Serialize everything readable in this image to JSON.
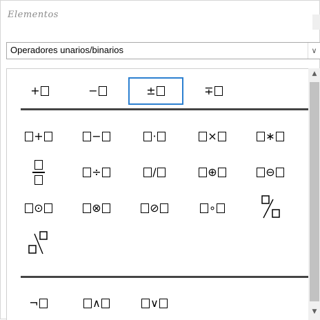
{
  "panel": {
    "title": "Elementos"
  },
  "category": {
    "selected": "Operadores unarios/binarios"
  },
  "icons": {
    "dropdown": "chevron-down-icon",
    "scroll_up": "chevron-up-icon",
    "scroll_down": "chevron-down-icon"
  },
  "colors": {
    "selection_border": "#2b7fd0",
    "separator": "#444444",
    "scrollbar_thumb": "#c2c2c2"
  },
  "sections": {
    "unary": [
      {
        "op": "+",
        "name": "plus"
      },
      {
        "op": "−",
        "name": "minus"
      },
      {
        "op": "±",
        "name": "plus-minus",
        "selected": true
      },
      {
        "op": "∓",
        "name": "minus-plus"
      }
    ],
    "binary": [
      {
        "op": "+",
        "name": "add"
      },
      {
        "op": "−",
        "name": "subtract"
      },
      {
        "op": "·",
        "name": "cdot"
      },
      {
        "op": "×",
        "name": "times"
      },
      {
        "op": "∗",
        "name": "asterisk"
      },
      {
        "op": "frac",
        "name": "fraction"
      },
      {
        "op": "÷",
        "name": "divide"
      },
      {
        "op": "/",
        "name": "slash"
      },
      {
        "op": "⊕",
        "name": "oplus"
      },
      {
        "op": "⊖",
        "name": "ominus"
      },
      {
        "op": "⊙",
        "name": "odot"
      },
      {
        "op": "⊗",
        "name": "otimes"
      },
      {
        "op": "⊘",
        "name": "oslash"
      },
      {
        "op": "∘",
        "name": "circ"
      },
      {
        "op": "wideslash",
        "name": "wide-slash"
      },
      {
        "op": "widebslash",
        "name": "wide-backslash"
      }
    ],
    "logic": [
      {
        "op": "¬",
        "name": "not"
      },
      {
        "op": "∧",
        "name": "and"
      },
      {
        "op": "∨",
        "name": "or"
      }
    ]
  }
}
